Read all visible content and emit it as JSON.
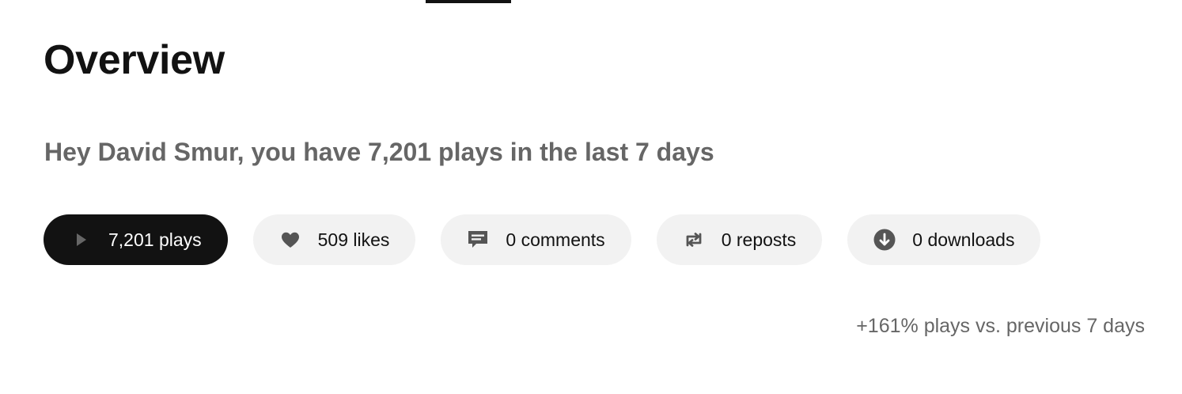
{
  "header": {
    "title": "Overview",
    "greeting": "Hey David Smur, you have 7,201 plays in the last 7 days"
  },
  "stats": {
    "plays": {
      "label": "7,201 plays",
      "icon": "play-icon",
      "active": true
    },
    "likes": {
      "label": "509 likes",
      "icon": "heart-icon",
      "active": false
    },
    "comments": {
      "label": "0 comments",
      "icon": "comment-icon",
      "active": false
    },
    "reposts": {
      "label": "0 reposts",
      "icon": "repost-icon",
      "active": false
    },
    "downloads": {
      "label": "0 downloads",
      "icon": "download-icon",
      "active": false
    }
  },
  "comparison": "+161% plays vs. previous 7 days",
  "colors": {
    "text_primary": "#121212",
    "text_secondary": "#666666",
    "pill_background": "#f2f2f2",
    "pill_active_background": "#121212",
    "icon_gray": "#666666"
  }
}
